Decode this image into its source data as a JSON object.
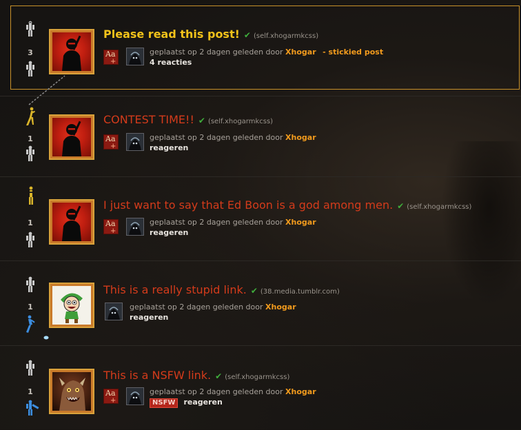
{
  "posts": [
    {
      "score": "3",
      "title": "Please read this post!",
      "domain": "(self.xhogarmkcss)",
      "meta_prefix": "geplaatst op 2 dagen geleden door",
      "author": "Xhogar",
      "stickied": "- stickied post",
      "comments": "4 reacties",
      "flair": "Aa",
      "flair_plus": "+",
      "thumb": "ninja-icon"
    },
    {
      "score": "1",
      "title": "CONTEST TIME!!",
      "domain": "(self.xhogarmkcss)",
      "meta_prefix": "geplaatst op 2 dagen geleden door",
      "author": "Xhogar",
      "comments": "reageren",
      "flair": "Aa",
      "flair_plus": "+",
      "thumb": "ninja-icon"
    },
    {
      "score": "1",
      "title": "I just want to say that Ed Boon is a god among men.",
      "domain": "(self.xhogarmkcss)",
      "meta_prefix": "geplaatst op 2 dagen geleden door",
      "author": "Xhogar",
      "comments": "reageren",
      "flair": "Aa",
      "flair_plus": "+",
      "thumb": "ninja-icon"
    },
    {
      "score": "1",
      "title": "This is a really stupid link.",
      "domain": "(38.media.tumblr.com)",
      "meta_prefix": "geplaatst op 2 dagen geleden door",
      "author": "Xhogar",
      "comments": "reageren",
      "thumb": "cartoon-character-icon"
    },
    {
      "score": "1",
      "title": "This is a NSFW link.",
      "domain": "(self.xhogarmkcss)",
      "meta_prefix": "geplaatst op 2 dagen geleden door",
      "author": "Xhogar",
      "nsfw": "NSFW",
      "comments": "reageren",
      "flair": "Aa",
      "flair_plus": "+",
      "thumb": "monster-icon"
    }
  ],
  "colors": {
    "accent": "#f29b1d",
    "title_red": "#d43b1b",
    "sticky_title": "#f2c21a",
    "thumb_border": "#d9a23b"
  }
}
